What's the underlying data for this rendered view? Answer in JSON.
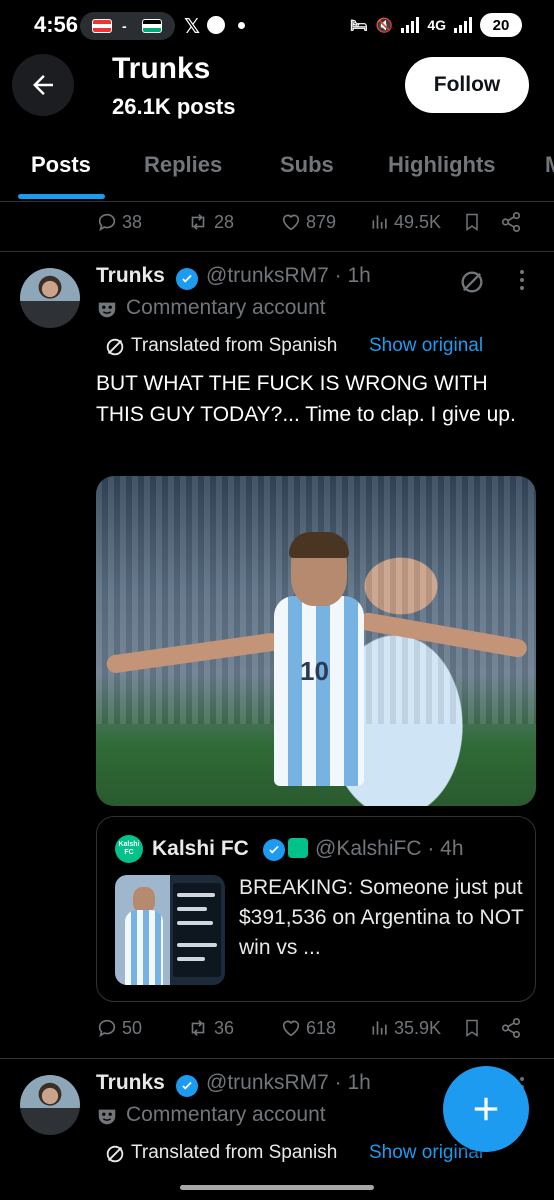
{
  "status_bar": {
    "time": "4:56",
    "separator": "-",
    "network": "4G",
    "battery": "20"
  },
  "header": {
    "title": "Trunks",
    "post_count": "26.1K posts",
    "follow_label": "Follow"
  },
  "tabs": [
    {
      "label": "Posts",
      "active": true
    },
    {
      "label": "Replies",
      "active": false
    },
    {
      "label": "Subs",
      "active": false
    },
    {
      "label": "Highlights",
      "active": false
    },
    {
      "label": "M",
      "active": false
    }
  ],
  "prev_post_stats": {
    "replies": "38",
    "reposts": "28",
    "likes": "879",
    "views": "49.5K"
  },
  "tweet1": {
    "author": "Trunks",
    "handle": "@trunksRM7 · 1h",
    "commentary": "Commentary account",
    "translated": "Translated from Spanish",
    "show_original": "Show original",
    "text": "BUT WHAT THE FUCK IS WRONG WITH THIS GUY TODAY?... Time to clap. I give up.",
    "media_number": "10",
    "quote": {
      "logo_text": "Kalshi FC",
      "name": "Kalshi FC",
      "handle": "@KalshiFC · 4h",
      "text": "BREAKING: Someone just put $391,536 on Argentina to NOT win vs ..."
    },
    "stats": {
      "replies": "50",
      "reposts": "36",
      "likes": "618",
      "views": "35.9K"
    }
  },
  "tweet2": {
    "author": "Trunks",
    "handle": "@trunksRM7 · 1h",
    "commentary": "Commentary account",
    "translated": "Translated from Spanish",
    "show_original": "Show original"
  },
  "colors": {
    "accent": "#1d9bf0",
    "muted": "#71767b",
    "border": "#2f3336",
    "background": "#000000"
  }
}
